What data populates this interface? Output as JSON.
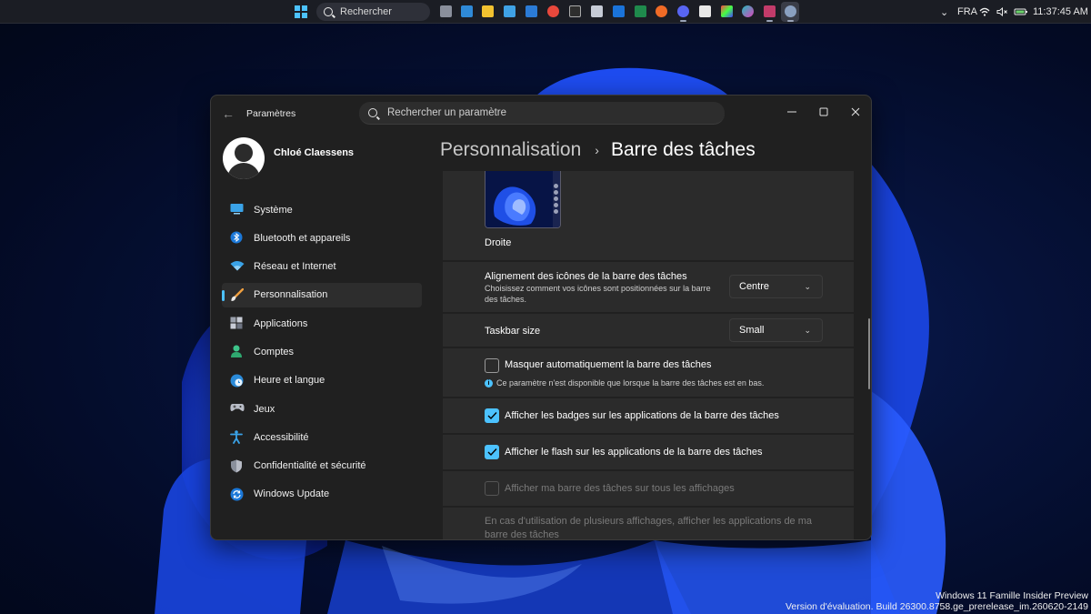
{
  "taskbar": {
    "search_placeholder": "Rechercher",
    "language": "FRA",
    "time": "11:37:45 AM",
    "apps": [
      "task-view",
      "photos",
      "file-explorer",
      "notepad",
      "mail",
      "chrome",
      "terminal",
      "calculator",
      "outlook",
      "excel",
      "firefox",
      "discord",
      "store",
      "paint",
      "copilot",
      "snipping-tool",
      "settings"
    ]
  },
  "window": {
    "app_title": "Paramètres",
    "search_placeholder": "Rechercher un paramètre",
    "user_name": "Chloé Claessens"
  },
  "nav": {
    "items": [
      {
        "label": "Système",
        "icon": "system-icon"
      },
      {
        "label": "Bluetooth et appareils",
        "icon": "bluetooth-icon"
      },
      {
        "label": "Réseau et Internet",
        "icon": "wifi-icon"
      },
      {
        "label": "Personnalisation",
        "icon": "brush-icon"
      },
      {
        "label": "Applications",
        "icon": "apps-icon"
      },
      {
        "label": "Comptes",
        "icon": "person-icon"
      },
      {
        "label": "Heure et langue",
        "icon": "globe-clock-icon"
      },
      {
        "label": "Jeux",
        "icon": "gamepad-icon"
      },
      {
        "label": "Accessibilité",
        "icon": "accessibility-icon"
      },
      {
        "label": "Confidentialité et sécurité",
        "icon": "shield-icon"
      },
      {
        "label": "Windows Update",
        "icon": "update-icon"
      }
    ],
    "selected": "Personnalisation"
  },
  "header": {
    "parent": "Personnalisation",
    "separator": "›",
    "current": "Barre des tâches"
  },
  "content": {
    "preview_label": "Droite",
    "alignment": {
      "title": "Alignement des icônes de la barre des tâches",
      "description": "Choisissez comment vos icônes sont positionnées sur la barre des tâches.",
      "value": "Centre"
    },
    "size": {
      "title": "Taskbar size",
      "value": "Small"
    },
    "autohide": {
      "label": "Masquer automatiquement la barre des tâches",
      "checked": false,
      "info": "Ce paramètre n'est disponible que lorsque la barre des tâches est en bas."
    },
    "badges": {
      "label": "Afficher les badges sur les applications de la barre des tâches",
      "checked": true
    },
    "flash": {
      "label": "Afficher le flash sur les applications de la barre des tâches",
      "checked": true
    },
    "all_displays": {
      "label": "Afficher ma barre des tâches sur tous les affichages",
      "checked": false,
      "disabled": true
    },
    "multi_display_text": "En cas d'utilisation de plusieurs affichages, afficher les applications de ma barre des tâches"
  },
  "watermark": {
    "line1": "Windows 11 Famille Insider Preview",
    "line2": "Version d'évaluation. Build 26300.8758.ge_prerelease_im.260620-2149"
  },
  "colors": {
    "accent": "#4cc2ff",
    "window_bg": "#202020",
    "card_bg": "#2b2b2b"
  }
}
